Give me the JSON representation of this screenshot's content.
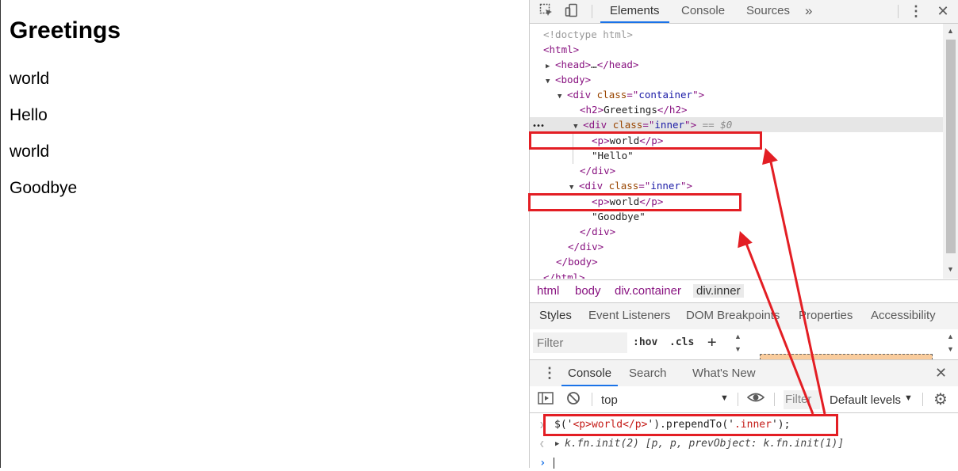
{
  "page": {
    "heading": "Greetings",
    "lines": [
      "world",
      "Hello",
      "world",
      "Goodbye"
    ]
  },
  "devtools": {
    "tabs": [
      "Elements",
      "Console",
      "Sources"
    ],
    "more_tabs_icon": "»",
    "tree": {
      "doctype": "<!doctype html>",
      "html_open": "html",
      "head": "head",
      "head_ellipsis": "…",
      "body": "body",
      "div": "div",
      "class_attr": "class",
      "container": "container",
      "h2": "h2",
      "h2_text": "Greetings",
      "inner": "inner",
      "selected_marker": "== $0",
      "p": "p",
      "p_text": "world",
      "text_hello": "\"Hello\"",
      "text_goodbye": "\"Goodbye\"",
      "html_close": "html"
    },
    "breadcrumbs": [
      "html",
      "body",
      "div.container",
      "div.inner"
    ],
    "sidebar_tabs": [
      "Styles",
      "Event Listeners",
      "DOM Breakpoints",
      "Properties",
      "Accessibility"
    ],
    "styles_filter_placeholder": "Filter",
    "hov_label": ":hov",
    "cls_label": ".cls",
    "drawer_tabs": [
      "Console",
      "Search",
      "What's New"
    ],
    "context": "top",
    "console_filter_placeholder": "Filter",
    "default_levels": "Default levels",
    "console_command": {
      "prefix": "$('",
      "arg1": "<p>world</p>",
      "mid": "').prependTo('",
      "arg2": ".inner",
      "suffix": "');"
    },
    "console_result": "k.fn.init(2) [p, p, prevObject: k.fn.init(1)]",
    "colors": {
      "tag": "#881280",
      "attribute": "#994500",
      "value": "#1a1aa6",
      "accent": "#1a73e8",
      "annotation": "#e31e24"
    }
  }
}
